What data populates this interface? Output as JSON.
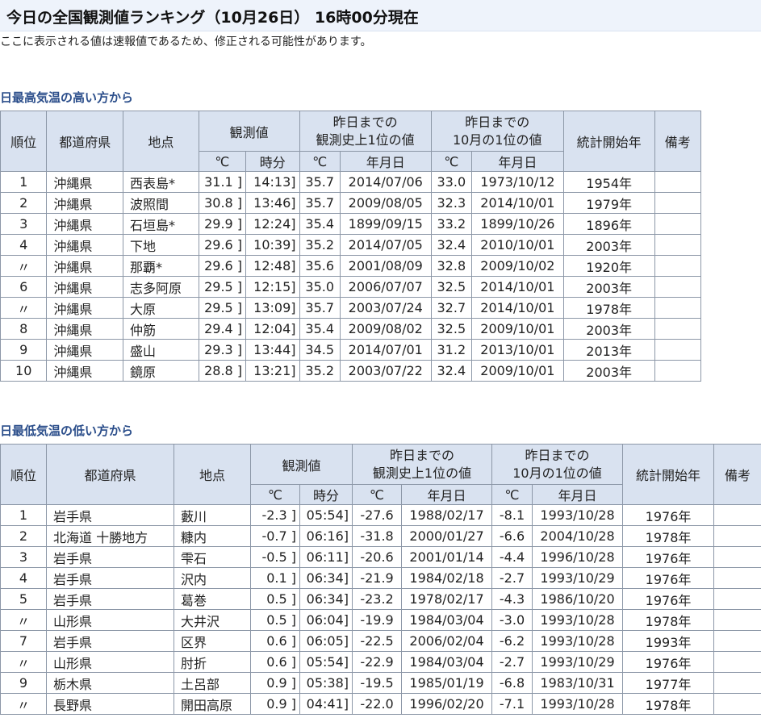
{
  "page": {
    "title": "今日の全国観測値ランキング（10月26日） 16時00分現在",
    "note": "ここに表示される値は速報値であるため、修正される可能性があります。"
  },
  "headers": {
    "rank": "順位",
    "prefecture": "都道府県",
    "station": "地点",
    "observed": "観測値",
    "record_line1": "昨日までの",
    "record_line2": "観測史上1位の値",
    "month_line1": "昨日までの",
    "month_line2": "10月の1位の値",
    "start_year": "統計開始年",
    "remarks": "備考",
    "deg": "℃",
    "time": "時分",
    "date": "年月日"
  },
  "high": {
    "heading": "日最高気温の高い方から",
    "rows": [
      {
        "rank": "1",
        "pref": "沖縄県",
        "station": "西表島*",
        "value": "31.1 ]",
        "time": "14:13]",
        "rec": "35.7",
        "rec_date": "2014/07/06",
        "mon": "33.0",
        "mon_date": "1973/10/12",
        "start": "1954年",
        "note": ""
      },
      {
        "rank": "2",
        "pref": "沖縄県",
        "station": "波照間",
        "value": "30.8 ]",
        "time": "13:46]",
        "rec": "35.7",
        "rec_date": "2009/08/05",
        "mon": "32.3",
        "mon_date": "2014/10/01",
        "start": "1979年",
        "note": ""
      },
      {
        "rank": "3",
        "pref": "沖縄県",
        "station": "石垣島*",
        "value": "29.9 ]",
        "time": "12:24]",
        "rec": "35.4",
        "rec_date": "1899/09/15",
        "mon": "33.2",
        "mon_date": "1899/10/26",
        "start": "1896年",
        "note": ""
      },
      {
        "rank": "4",
        "pref": "沖縄県",
        "station": "下地",
        "value": "29.6 ]",
        "time": "10:39]",
        "rec": "35.2",
        "rec_date": "2014/07/05",
        "mon": "32.4",
        "mon_date": "2010/10/01",
        "start": "2003年",
        "note": ""
      },
      {
        "rank": "〃",
        "pref": "沖縄県",
        "station": "那覇*",
        "value": "29.6 ]",
        "time": "12:48]",
        "rec": "35.6",
        "rec_date": "2001/08/09",
        "mon": "32.8",
        "mon_date": "2009/10/02",
        "start": "1920年",
        "note": ""
      },
      {
        "rank": "6",
        "pref": "沖縄県",
        "station": "志多阿原",
        "value": "29.5 ]",
        "time": "12:15]",
        "rec": "35.0",
        "rec_date": "2006/07/07",
        "mon": "32.5",
        "mon_date": "2014/10/01",
        "start": "2003年",
        "note": ""
      },
      {
        "rank": "〃",
        "pref": "沖縄県",
        "station": "大原",
        "value": "29.5 ]",
        "time": "13:09]",
        "rec": "35.7",
        "rec_date": "2003/07/24",
        "mon": "32.7",
        "mon_date": "2014/10/01",
        "start": "1978年",
        "note": ""
      },
      {
        "rank": "8",
        "pref": "沖縄県",
        "station": "仲筋",
        "value": "29.4 ]",
        "time": "12:04]",
        "rec": "35.4",
        "rec_date": "2009/08/02",
        "mon": "32.5",
        "mon_date": "2009/10/01",
        "start": "2003年",
        "note": ""
      },
      {
        "rank": "9",
        "pref": "沖縄県",
        "station": "盛山",
        "value": "29.3 ]",
        "time": "13:44]",
        "rec": "34.5",
        "rec_date": "2014/07/01",
        "mon": "31.2",
        "mon_date": "2013/10/01",
        "start": "2013年",
        "note": ""
      },
      {
        "rank": "10",
        "pref": "沖縄県",
        "station": "鏡原",
        "value": "28.8 ]",
        "time": "13:21]",
        "rec": "35.2",
        "rec_date": "2003/07/22",
        "mon": "32.4",
        "mon_date": "2009/10/01",
        "start": "2003年",
        "note": ""
      }
    ]
  },
  "low": {
    "heading": "日最低気温の低い方から",
    "rows": [
      {
        "rank": "1",
        "pref": "岩手県",
        "station": "藪川",
        "value": "-2.3 ]",
        "time": "05:54]",
        "rec": "-27.6",
        "rec_date": "1988/02/17",
        "mon": "-8.1",
        "mon_date": "1993/10/28",
        "start": "1976年",
        "note": ""
      },
      {
        "rank": "2",
        "pref": "北海道 十勝地方",
        "station": "糠内",
        "value": "-0.7 ]",
        "time": "06:16]",
        "rec": "-31.8",
        "rec_date": "2000/01/27",
        "mon": "-6.6",
        "mon_date": "2004/10/28",
        "start": "1978年",
        "note": ""
      },
      {
        "rank": "3",
        "pref": "岩手県",
        "station": "雫石",
        "value": "-0.5 ]",
        "time": "06:11]",
        "rec": "-20.6",
        "rec_date": "2001/01/14",
        "mon": "-4.4",
        "mon_date": "1996/10/28",
        "start": "1976年",
        "note": ""
      },
      {
        "rank": "4",
        "pref": "岩手県",
        "station": "沢内",
        "value": "0.1 ]",
        "time": "06:34]",
        "rec": "-21.9",
        "rec_date": "1984/02/18",
        "mon": "-2.7",
        "mon_date": "1993/10/29",
        "start": "1976年",
        "note": ""
      },
      {
        "rank": "5",
        "pref": "岩手県",
        "station": "葛巻",
        "value": "0.5 ]",
        "time": "06:34]",
        "rec": "-23.2",
        "rec_date": "1978/02/17",
        "mon": "-4.3",
        "mon_date": "1986/10/20",
        "start": "1976年",
        "note": ""
      },
      {
        "rank": "〃",
        "pref": "山形県",
        "station": "大井沢",
        "value": "0.5 ]",
        "time": "06:04]",
        "rec": "-19.9",
        "rec_date": "1984/03/04",
        "mon": "-3.0",
        "mon_date": "1993/10/28",
        "start": "1978年",
        "note": ""
      },
      {
        "rank": "7",
        "pref": "岩手県",
        "station": "区界",
        "value": "0.6 ]",
        "time": "06:05]",
        "rec": "-22.5",
        "rec_date": "2006/02/04",
        "mon": "-6.2",
        "mon_date": "1993/10/28",
        "start": "1993年",
        "note": ""
      },
      {
        "rank": "〃",
        "pref": "山形県",
        "station": "肘折",
        "value": "0.6 ]",
        "time": "05:54]",
        "rec": "-22.9",
        "rec_date": "1984/03/04",
        "mon": "-2.7",
        "mon_date": "1993/10/29",
        "start": "1976年",
        "note": ""
      },
      {
        "rank": "9",
        "pref": "栃木県",
        "station": "土呂部",
        "value": "0.9 ]",
        "time": "05:38]",
        "rec": "-19.5",
        "rec_date": "1985/01/19",
        "mon": "-6.8",
        "mon_date": "1983/10/31",
        "start": "1977年",
        "note": ""
      },
      {
        "rank": "〃",
        "pref": "長野県",
        "station": "開田高原",
        "value": "0.9 ]",
        "time": "04:41]",
        "rec": "-22.0",
        "rec_date": "1996/02/20",
        "mon": "-7.1",
        "mon_date": "1993/10/28",
        "start": "1978年",
        "note": ""
      }
    ]
  }
}
